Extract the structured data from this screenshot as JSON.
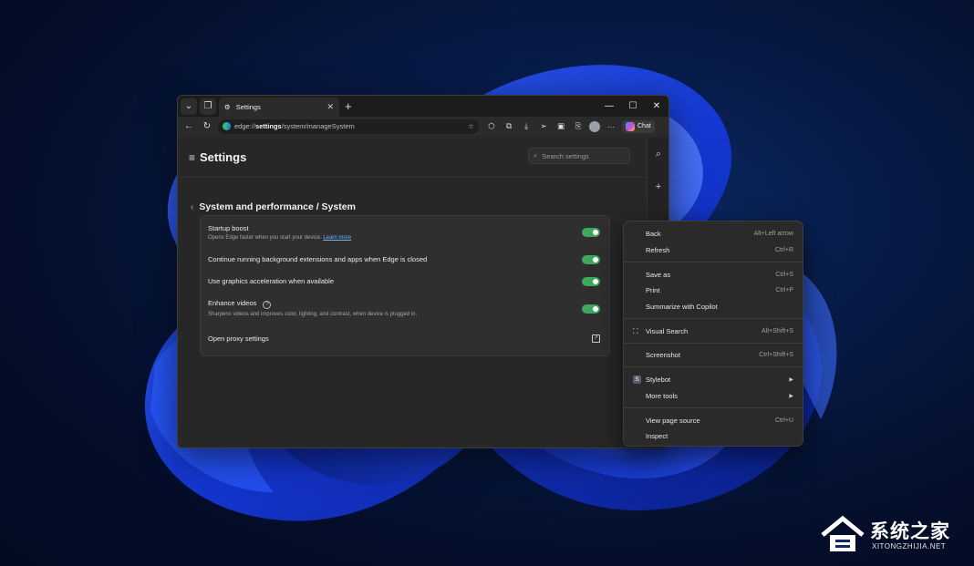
{
  "browser": {
    "tab_title": "Settings",
    "address_prefix": "edge://",
    "address_bold": "settings",
    "address_rest": "/system/manageSystem",
    "chat_label": "Chat"
  },
  "settings": {
    "title": "Settings",
    "search_placeholder": "Search settings",
    "breadcrumb": "System and performance  /  System",
    "rows": [
      {
        "label": "Startup boost",
        "sub": "Opens Edge faster when you start your device.",
        "link": "Learn more",
        "enabled": true
      },
      {
        "label": "Continue running background extensions and apps when Edge is closed",
        "enabled": true
      },
      {
        "label": "Use graphics acceleration when available",
        "enabled": true
      },
      {
        "label": "Enhance videos",
        "sub": "Sharpens videos and improves color, lighting, and contrast, when device is plugged in.",
        "enabled": true
      },
      {
        "label": "Open proxy settings"
      }
    ]
  },
  "context_menu": {
    "items": [
      {
        "label": "Back",
        "shortcut": "Alt+Left arrow"
      },
      {
        "label": "Refresh",
        "shortcut": "Ctrl+R"
      },
      {
        "label": "Save as",
        "shortcut": "Ctrl+S"
      },
      {
        "label": "Print",
        "shortcut": "Ctrl+P"
      },
      {
        "label": "Summarize with Copilot",
        "shortcut": ""
      },
      {
        "label": "Visual Search",
        "shortcut": "Alt+Shift+S"
      },
      {
        "label": "Screenshot",
        "shortcut": "Ctrl+Shift+S"
      },
      {
        "label": "Stylebot",
        "shortcut": ""
      },
      {
        "label": "More tools",
        "shortcut": ""
      },
      {
        "label": "View page source",
        "shortcut": "Ctrl+U"
      },
      {
        "label": "Inspect",
        "shortcut": ""
      }
    ],
    "stylebot_icon_letter": "S"
  },
  "watermark": {
    "title": "系统之家",
    "url": "XITONGZHIJIA.NET"
  },
  "colors": {
    "toggle_on": "#3fa75b",
    "link": "#6fb3ff",
    "wallpaper_blue": "#1a4dff"
  },
  "icons": [
    "workspaces-icon",
    "settings-gear-icon",
    "back-arrow-icon",
    "refresh-icon",
    "edge-logo-icon",
    "favorite-star-icon",
    "extensions-icon",
    "collections-icon",
    "downloads-icon",
    "share-icon",
    "screenshot-icon",
    "profile-avatar",
    "more-icon",
    "copilot-icon",
    "search-icon",
    "add-icon",
    "external-link-icon",
    "help-icon"
  ]
}
